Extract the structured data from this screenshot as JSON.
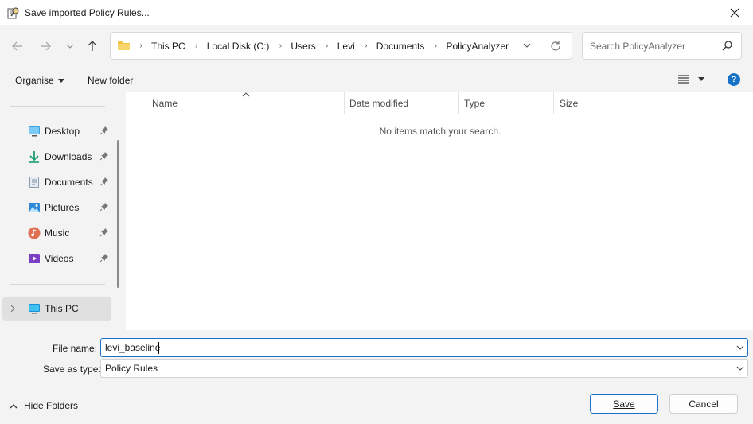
{
  "window": {
    "title": "Save imported Policy Rules..."
  },
  "address_bar": {
    "crumbs": [
      "This PC",
      "Local Disk (C:)",
      "Users",
      "Levi",
      "Documents",
      "PolicyAnalyzer"
    ]
  },
  "search": {
    "placeholder": "Search PolicyAnalyzer"
  },
  "commands": {
    "organise": "Organise",
    "new_folder": "New folder",
    "help": "?"
  },
  "nav_pane": {
    "quick_access": [
      {
        "label": "Desktop",
        "icon": "desktop-icon"
      },
      {
        "label": "Downloads",
        "icon": "downloads-icon"
      },
      {
        "label": "Documents",
        "icon": "documents-icon"
      },
      {
        "label": "Pictures",
        "icon": "pictures-icon"
      },
      {
        "label": "Music",
        "icon": "music-icon"
      },
      {
        "label": "Videos",
        "icon": "videos-icon"
      }
    ],
    "this_pc": "This PC"
  },
  "columns": [
    "Name",
    "Date modified",
    "Type",
    "Size"
  ],
  "content": {
    "empty_message": "No items match your search."
  },
  "form": {
    "file_name_label": "File name:",
    "file_name_value": "levi_baseline",
    "save_type_label": "Save as type:",
    "save_type_value": "Policy Rules"
  },
  "footer": {
    "hide_folders": "Hide Folders",
    "save": "Save",
    "cancel": "Cancel"
  },
  "colors": {
    "accent": "#1872c8",
    "window_bg": "#f3f3f3",
    "content_bg": "#ffffff"
  }
}
